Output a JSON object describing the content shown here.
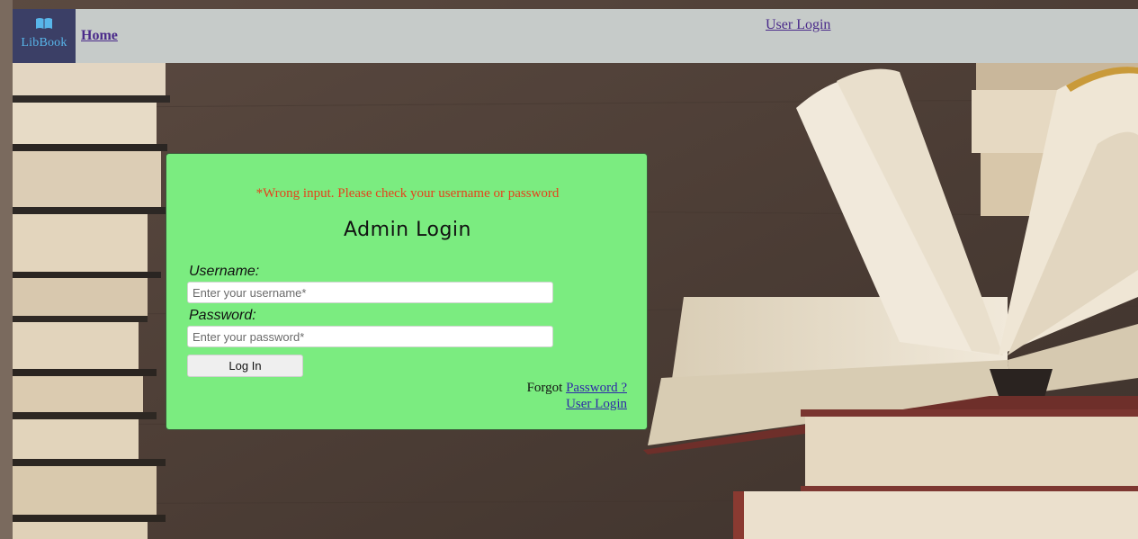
{
  "navbar": {
    "logo_text": "LibBook",
    "home_label": "Home",
    "user_login_label": "User Login"
  },
  "login_card": {
    "error_message": "*Wrong input. Please check your username or password",
    "title": "Admin Login",
    "username_label": "Username:",
    "username_placeholder": "Enter your username*",
    "username_value": "",
    "password_label": "Password:",
    "password_placeholder": "Enter your password*",
    "password_value": "",
    "login_button_label": "Log In",
    "forgot_prefix": "Forgot",
    "forgot_link_label": "Password ?",
    "user_login_link_label": "User Login"
  },
  "colors": {
    "card_background": "#7bec80",
    "navbar_background": "#c6cbc9",
    "logo_background": "#3b3f66",
    "error_text": "#e5421b",
    "link": "#2f2aa8"
  }
}
